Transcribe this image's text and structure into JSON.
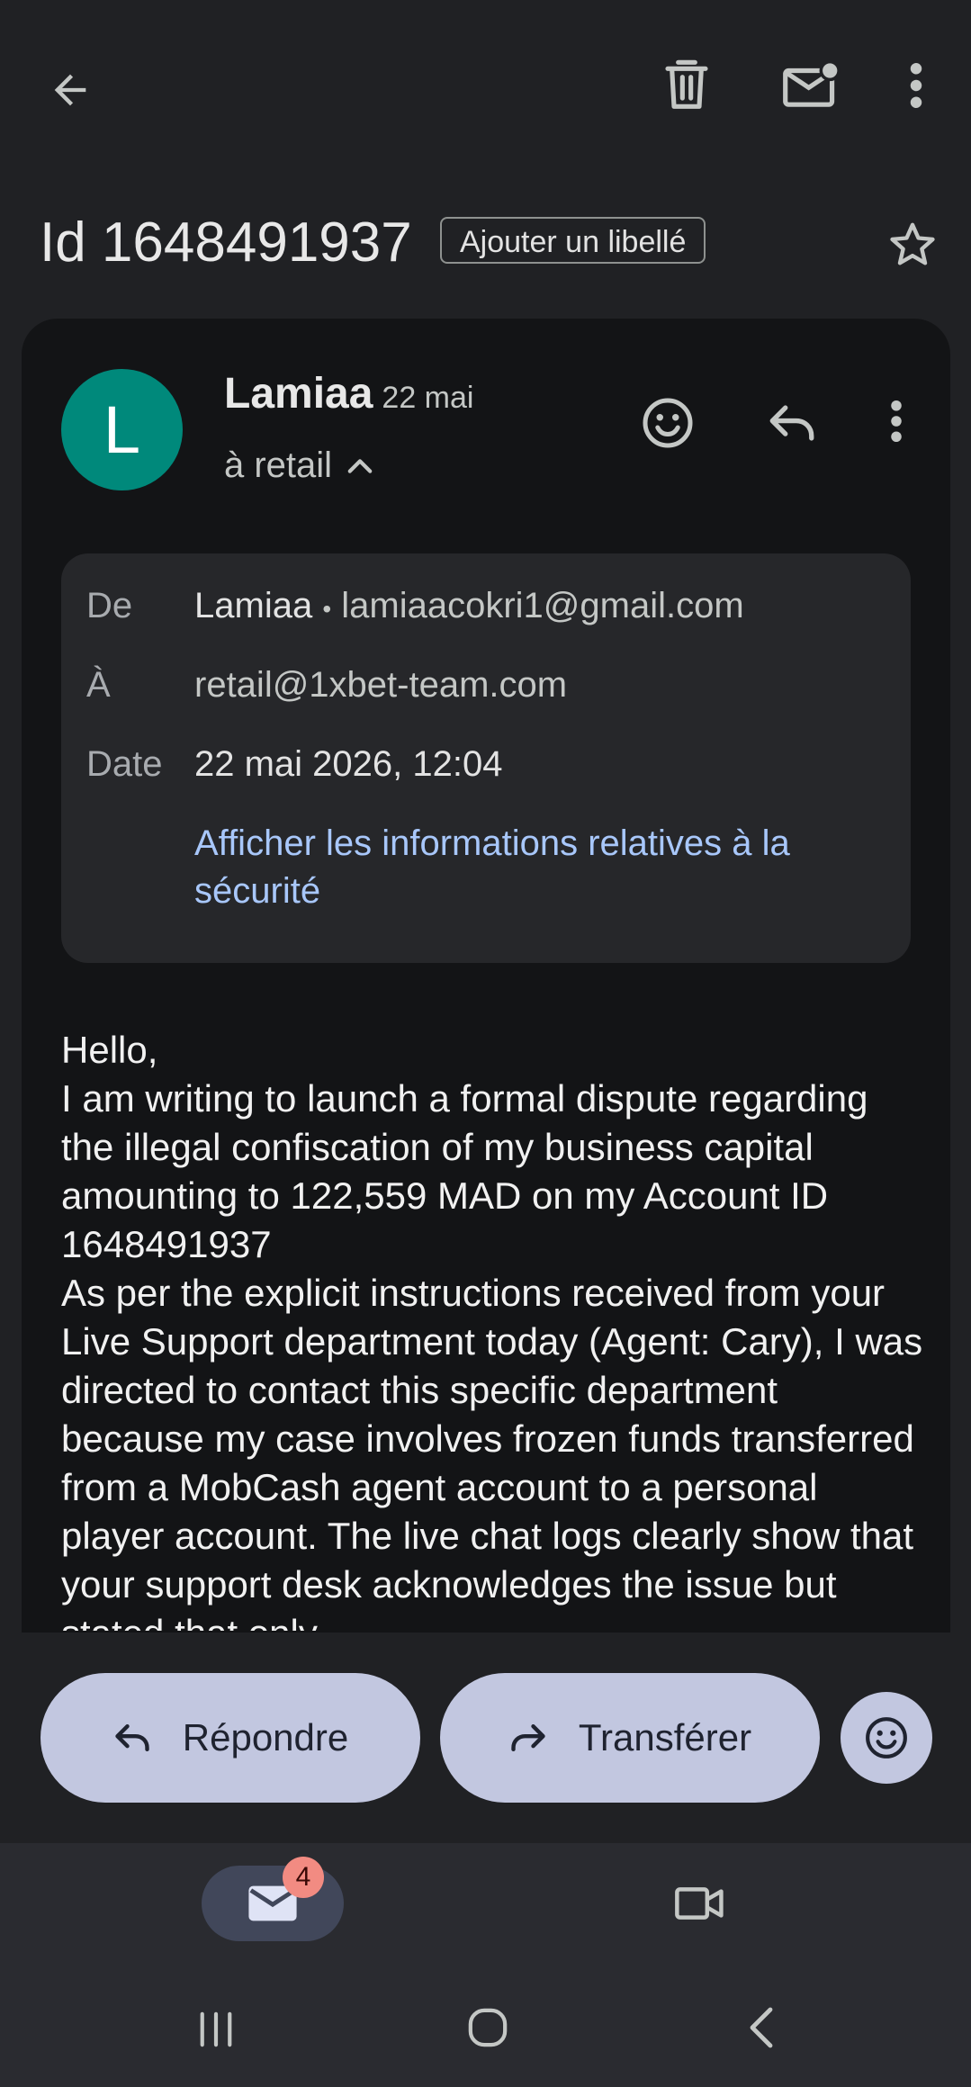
{
  "subject": {
    "title": "Id 1648491937",
    "add_label": "Ajouter un libellé"
  },
  "message": {
    "sender_initial": "L",
    "sender_name": "Lamiaa",
    "short_date": "22 mai",
    "to_summary": "à retail",
    "details": {
      "from_label": "De",
      "from_name": "Lamiaa",
      "from_separator": "•",
      "from_email": "lamiaacokri1@gmail.com",
      "to_label": "À",
      "to_value": "retail@1xbet-team.com",
      "date_label": "Date",
      "date_value": "22 mai 2026, 12:04",
      "security_link": "Afficher les informations relatives à la sécurité"
    },
    "body": [
      "Hello,",
      "I am writing to launch a formal dispute regarding the illegal confiscation of my business capital amounting to 122,559 MAD on my Account ID 1648491937",
      "As per the explicit instructions received from your Live Support department today (Agent: Cary), I was directed to contact this specific department because my case involves frozen funds transferred from a MobCash agent account to a personal player account. The live chat logs clearly show that your support desk acknowledges the issue but stated that only"
    ]
  },
  "actions": {
    "reply": "Répondre",
    "forward": "Transférer"
  },
  "bottom_nav": {
    "mail_badge": "4"
  },
  "colors": {
    "background": "#202124",
    "card": "#131416",
    "avatar": "#00897b",
    "link": "#a8c7fa",
    "pill": "#c2c7e0",
    "badge": "#f28b82"
  }
}
